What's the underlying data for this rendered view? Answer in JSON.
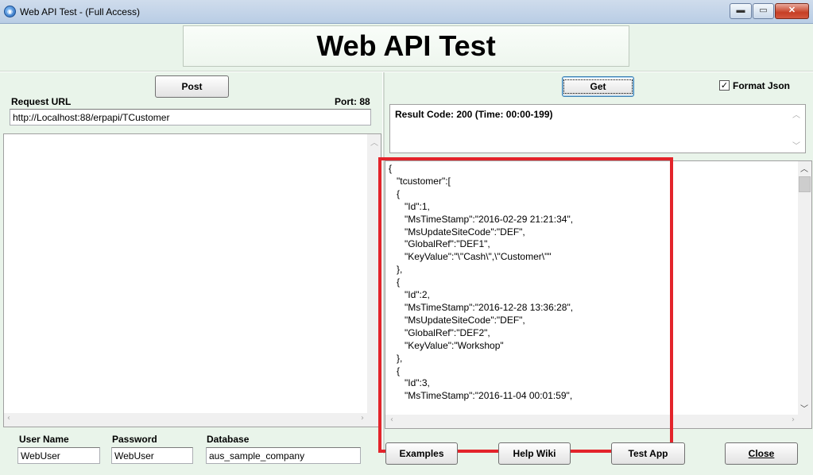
{
  "window": {
    "title": "Web API Test - (Full Access)",
    "icon": "globe-app-icon",
    "controls": [
      "minimize",
      "maximize",
      "close"
    ]
  },
  "header": {
    "title": "Web API Test"
  },
  "request": {
    "post_label": "Post",
    "url_label": "Request URL",
    "port_label": "Port: 88",
    "url_value": "http://Localhost:88/erpapi/TCustomer",
    "body_value": ""
  },
  "response": {
    "get_label": "Get",
    "format_json_label": "Format Json",
    "format_json_checked": true,
    "result_code_text": "Result Code: 200 (Time: 00:00-199)",
    "json_lines": [
      "{",
      "   \"tcustomer\":[",
      "   {",
      "      \"Id\":1,",
      "      \"MsTimeStamp\":\"2016-02-29 21:21:34\",",
      "      \"MsUpdateSiteCode\":\"DEF\",",
      "      \"GlobalRef\":\"DEF1\",",
      "      \"KeyValue\":\"\\\"Cash\\\",\\\"Customer\\\"\"",
      "   },",
      "   {",
      "      \"Id\":2,",
      "      \"MsTimeStamp\":\"2016-12-28 13:36:28\",",
      "      \"MsUpdateSiteCode\":\"DEF\",",
      "      \"GlobalRef\":\"DEF2\",",
      "      \"KeyValue\":\"Workshop\"",
      "   },",
      "   {",
      "      \"Id\":3,",
      "      \"MsTimeStamp\":\"2016-11-04 00:01:59\","
    ]
  },
  "footer": {
    "username_label": "User Name",
    "username_value": "WebUser",
    "password_label": "Password",
    "password_value": "WebUser",
    "database_label": "Database",
    "database_value": "aus_sample_company",
    "examples_label": "Examples",
    "helpwiki_label": "Help Wiki",
    "testapp_label": "Test App",
    "close_label": "Close"
  },
  "colors": {
    "client_bg": "#e9f4ea",
    "highlight": "#e3242b",
    "titlebar": "#b9cde5"
  }
}
